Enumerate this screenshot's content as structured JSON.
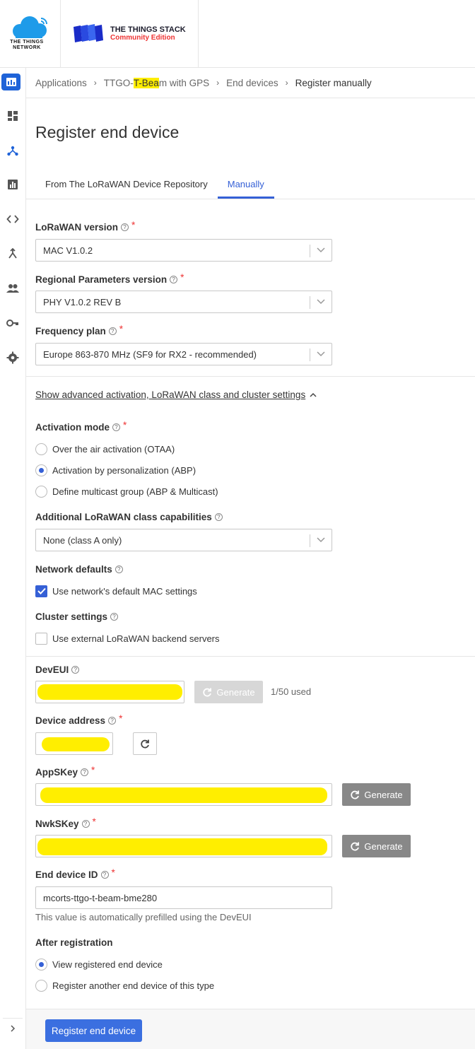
{
  "brand": {
    "ttn_line1": "THE THINGS",
    "ttn_line2": "NETWORK",
    "tts_title": "THE THINGS STACK",
    "tts_subtitle": "Community Edition"
  },
  "sidebar": {
    "items": [
      {
        "icon": "overview-icon"
      },
      {
        "icon": "dashboard-icon"
      },
      {
        "icon": "end-devices-icon"
      },
      {
        "icon": "live-data-icon"
      },
      {
        "icon": "payload-formatters-icon"
      },
      {
        "icon": "integrations-icon"
      },
      {
        "icon": "collaborators-icon"
      },
      {
        "icon": "api-keys-icon"
      },
      {
        "icon": "general-settings-icon"
      }
    ]
  },
  "breadcrumb": {
    "item1": "Applications",
    "item2_pre": "TTGO-",
    "item2_hl": "T-Bea",
    "item2_post": "m with GPS",
    "item3": "End devices",
    "item4": "Register manually"
  },
  "page": {
    "title": "Register end device"
  },
  "tabs": {
    "repo": "From The LoRaWAN Device Repository",
    "manual": "Manually"
  },
  "form": {
    "lorawan_version_label": "LoRaWAN version",
    "lorawan_version_value": "MAC V1.0.2",
    "regional_label": "Regional Parameters version",
    "regional_value": "PHY V1.0.2 REV B",
    "freq_label": "Frequency plan",
    "freq_value": "Europe 863-870 MHz (SF9 for RX2 - recommended)",
    "advanced_link": "Show advanced activation, LoRaWAN class and cluster settings",
    "activation_label": "Activation mode",
    "activation_options": [
      "Over the air activation (OTAA)",
      "Activation by personalization (ABP)",
      "Define multicast group (ABP & Multicast)"
    ],
    "class_label": "Additional LoRaWAN class capabilities",
    "class_value": "None (class A only)",
    "network_defaults_label": "Network defaults",
    "network_defaults_check": "Use network's default MAC settings",
    "cluster_label": "Cluster settings",
    "cluster_check": "Use external LoRaWAN backend servers",
    "deveui_label": "DevEUI",
    "generate": "Generate",
    "deveui_used": "1/50 used",
    "devaddr_label": "Device address",
    "appskey_label": "AppSKey",
    "nwkskey_label": "NwkSKey",
    "device_id_label": "End device ID",
    "device_id_value": "mcorts-ttgo-t-beam-bme280",
    "device_id_hint": "This value is automatically prefilled using the DevEUI",
    "after_label": "After registration",
    "after_options": [
      "View registered end device",
      "Register another end device of this type"
    ],
    "submit": "Register end device"
  }
}
